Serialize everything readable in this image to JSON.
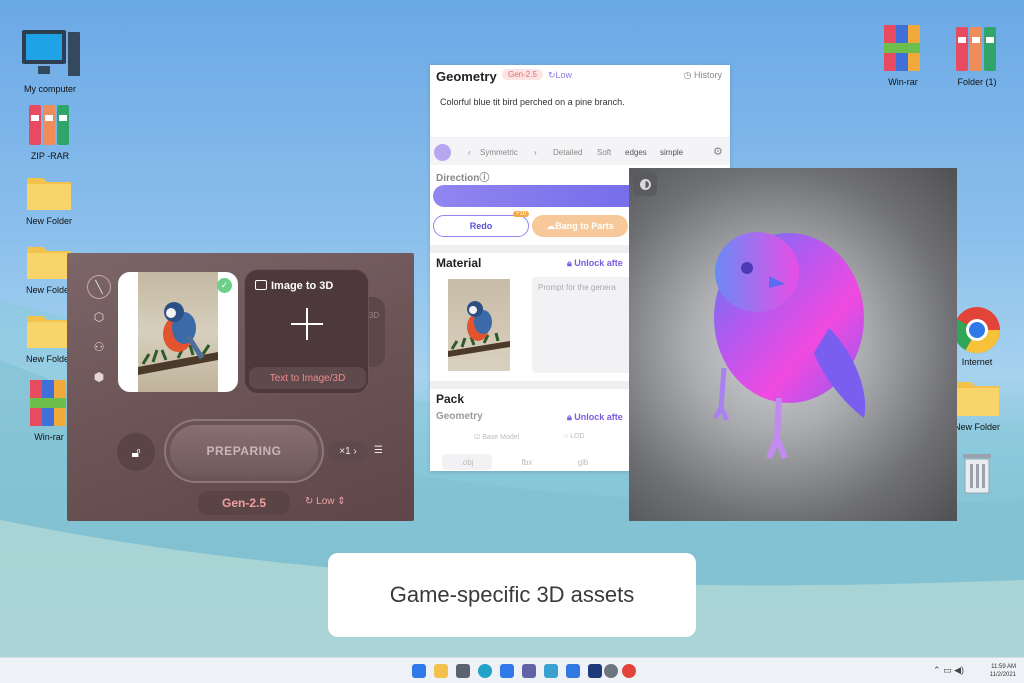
{
  "desktop": {
    "left_icons": [
      {
        "label": "My computer",
        "icon": "computer-icon"
      },
      {
        "label": "ZIP -RAR",
        "icon": "archive-icon"
      },
      {
        "label": "New Folder",
        "icon": "folder-icon"
      },
      {
        "label": "New Folder",
        "icon": "folder-icon"
      },
      {
        "label": "New Folder",
        "icon": "folder-icon"
      },
      {
        "label": "Win-rar",
        "icon": "winrar-icon"
      }
    ],
    "right_icons": [
      {
        "label": "Win-rar",
        "icon": "winrar-icon"
      },
      {
        "label": "Folder (1)",
        "icon": "archive-icon"
      },
      {
        "label": "Internet",
        "icon": "chrome-icon"
      },
      {
        "label": "New Folder",
        "icon": "folder-icon"
      },
      {
        "label": "",
        "icon": "recycle-bin-icon"
      }
    ]
  },
  "generator": {
    "image_to_3d_label": "Image to 3D",
    "text_to_3d_label": "Text to Image/3D",
    "ghost_label": "3D",
    "status_button": "PREPARING",
    "multiplier": "×1",
    "model": "Gen-2.5",
    "quality": "Low"
  },
  "geometry_panel": {
    "title": "Geometry",
    "model_badge": "Gen-2.5",
    "quality": "Low",
    "history": "History",
    "prompt": "Colorful blue tit bird perched on a pine branch.",
    "toolbar": [
      "Symmetric",
      "Detailed",
      "Soft",
      "edges",
      "simple"
    ],
    "direction_label": "Direction",
    "redo": "Redo",
    "redo_cost": "+10",
    "bang_to_parts": "Bang to Parts",
    "material_title": "Material",
    "unlock_after": "Unlock afte",
    "material_prompt_placeholder": "Prompt for the genera",
    "pack_title": "Pack",
    "pack_geometry": "Geometry",
    "pack_options": [
      "Base Model",
      "LOD"
    ],
    "formats": [
      ".obj",
      "fbx",
      "glb"
    ]
  },
  "preview": {
    "subject": "blue tit bird normal map render"
  },
  "caption": "Game-specific 3D assets",
  "taskbar": {
    "time": "11:59 AM",
    "date": "11/2/2021"
  },
  "colors": {
    "accent_purple": "#6b62e8",
    "gen_pink": "#e36b6b",
    "panel_brown": "#6d5558"
  }
}
